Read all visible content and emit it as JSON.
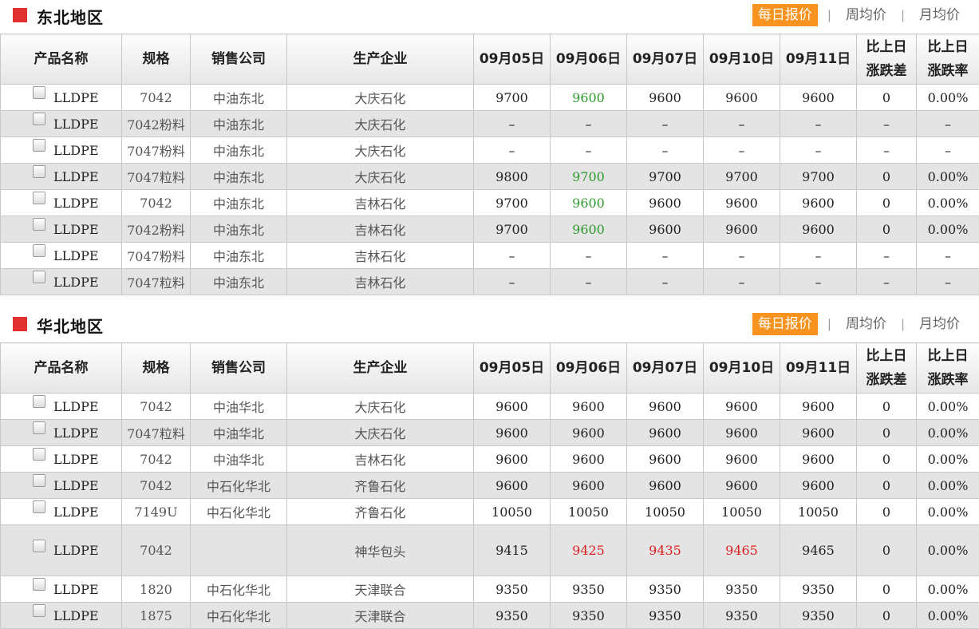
{
  "tabs": [
    "每日报价",
    "周均价",
    "月均价"
  ],
  "columns": [
    "产品名称",
    "规格",
    "销售公司",
    "生产企业",
    "09月05日",
    "09月06日",
    "09月07日",
    "09月10日",
    "09月11日",
    "比上日涨跌差",
    "比上日涨跌率"
  ],
  "colors": {
    "accent": "#f7931e",
    "marker": "#e03030",
    "up": "#e02020",
    "down": "#2e9a2e"
  },
  "sections": [
    {
      "title": "东北地区",
      "rows": [
        {
          "product": "LLDPE",
          "spec": "7042",
          "company": "中油东北",
          "producer": "大庆石化",
          "p1": "9700",
          "p2": "9600",
          "p3": "9600",
          "p4": "9600",
          "p5": "9600",
          "diff": "0",
          "rate": "0.00%"
        },
        {
          "product": "LLDPE",
          "spec": "7042粉料",
          "company": "中油东北",
          "producer": "大庆石化",
          "p1": "–",
          "p2": "–",
          "p3": "–",
          "p4": "–",
          "p5": "–",
          "diff": "–",
          "rate": "–"
        },
        {
          "product": "LLDPE",
          "spec": "7047粉料",
          "company": "中油东北",
          "producer": "大庆石化",
          "p1": "–",
          "p2": "–",
          "p3": "–",
          "p4": "–",
          "p5": "–",
          "diff": "–",
          "rate": "–"
        },
        {
          "product": "LLDPE",
          "spec": "7047粒料",
          "company": "中油东北",
          "producer": "大庆石化",
          "p1": "9800",
          "p2": "9700",
          "p3": "9700",
          "p4": "9700",
          "p5": "9700",
          "diff": "0",
          "rate": "0.00%"
        },
        {
          "product": "LLDPE",
          "spec": "7042",
          "company": "中油东北",
          "producer": "吉林石化",
          "p1": "9700",
          "p2": "9600",
          "p3": "9600",
          "p4": "9600",
          "p5": "9600",
          "diff": "0",
          "rate": "0.00%"
        },
        {
          "product": "LLDPE",
          "spec": "7042粉料",
          "company": "中油东北",
          "producer": "吉林石化",
          "p1": "9700",
          "p2": "9600",
          "p3": "9600",
          "p4": "9600",
          "p5": "9600",
          "diff": "0",
          "rate": "0.00%"
        },
        {
          "product": "LLDPE",
          "spec": "7047粉料",
          "company": "中油东北",
          "producer": "吉林石化",
          "p1": "–",
          "p2": "–",
          "p3": "–",
          "p4": "–",
          "p5": "–",
          "diff": "–",
          "rate": "–"
        },
        {
          "product": "LLDPE",
          "spec": "7047粒料",
          "company": "中油东北",
          "producer": "吉林石化",
          "p1": "–",
          "p2": "–",
          "p3": "–",
          "p4": "–",
          "p5": "–",
          "diff": "–",
          "rate": "–"
        }
      ]
    },
    {
      "title": "华北地区",
      "rows": [
        {
          "product": "LLDPE",
          "spec": "7042",
          "company": "中油华北",
          "producer": "大庆石化",
          "p1": "9600",
          "p2": "9600",
          "p3": "9600",
          "p4": "9600",
          "p5": "9600",
          "diff": "0",
          "rate": "0.00%"
        },
        {
          "product": "LLDPE",
          "spec": "7047粒料",
          "company": "中油华北",
          "producer": "大庆石化",
          "p1": "9600",
          "p2": "9600",
          "p3": "9600",
          "p4": "9600",
          "p5": "9600",
          "diff": "0",
          "rate": "0.00%"
        },
        {
          "product": "LLDPE",
          "spec": "7042",
          "company": "中油华北",
          "producer": "吉林石化",
          "p1": "9600",
          "p2": "9600",
          "p3": "9600",
          "p4": "9600",
          "p5": "9600",
          "diff": "0",
          "rate": "0.00%"
        },
        {
          "product": "LLDPE",
          "spec": "7042",
          "company": "中石化华北",
          "producer": "齐鲁石化",
          "p1": "9600",
          "p2": "9600",
          "p3": "9600",
          "p4": "9600",
          "p5": "9600",
          "diff": "0",
          "rate": "0.00%"
        },
        {
          "product": "LLDPE",
          "spec": "7149U",
          "company": "中石化华北",
          "producer": "齐鲁石化",
          "p1": "10050",
          "p2": "10050",
          "p3": "10050",
          "p4": "10050",
          "p5": "10050",
          "diff": "0",
          "rate": "0.00%"
        },
        {
          "product": "LLDPE",
          "spec": "7042",
          "company": "",
          "producer": "神华包头",
          "p1": "9415",
          "p2": "9425",
          "p3": "9435",
          "p4": "9465",
          "p5": "9465",
          "diff": "0",
          "rate": "0.00%"
        },
        {
          "product": "LLDPE",
          "spec": "1820",
          "company": "中石化华北",
          "producer": "天津联合",
          "p1": "9350",
          "p2": "9350",
          "p3": "9350",
          "p4": "9350",
          "p5": "9350",
          "diff": "0",
          "rate": "0.00%"
        },
        {
          "product": "LLDPE",
          "spec": "1875",
          "company": "中石化华北",
          "producer": "天津联合",
          "p1": "9350",
          "p2": "9350",
          "p3": "9350",
          "p4": "9350",
          "p5": "9350",
          "diff": "0",
          "rate": "0.00%"
        }
      ]
    }
  ]
}
